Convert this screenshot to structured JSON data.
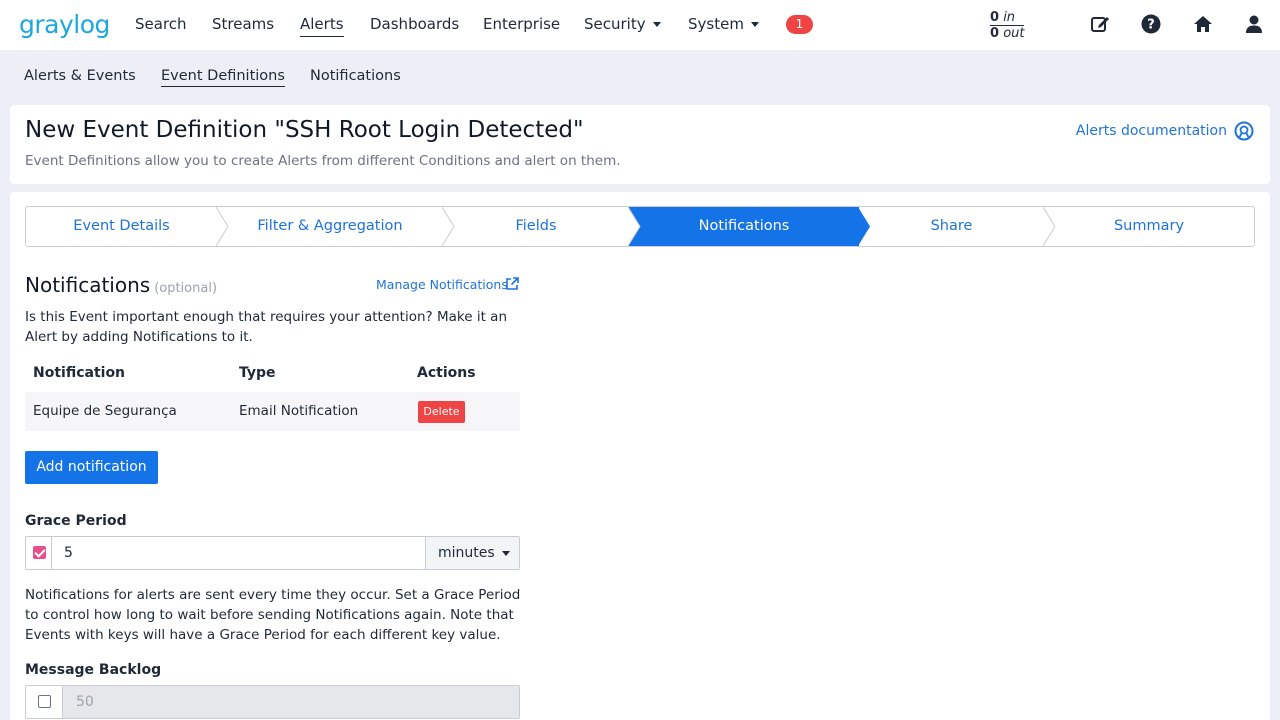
{
  "brand": {
    "logo_text": "graylog",
    "logo_color": "#1ba8e0"
  },
  "topnav": {
    "items": [
      {
        "label": "Search"
      },
      {
        "label": "Streams"
      },
      {
        "label": "Alerts"
      },
      {
        "label": "Dashboards"
      },
      {
        "label": "Enterprise"
      },
      {
        "label": "Security"
      },
      {
        "label": "System"
      }
    ],
    "notification_count": "1",
    "throughput": {
      "in_value": "0",
      "in_label": "in",
      "out_value": "0",
      "out_label": "out"
    },
    "icons": [
      "edit-icon",
      "help-icon",
      "home-icon",
      "user-icon"
    ]
  },
  "subnav": {
    "items": [
      {
        "label": "Alerts & Events"
      },
      {
        "label": "Event Definitions"
      },
      {
        "label": "Notifications"
      }
    ]
  },
  "header": {
    "title": "New Event Definition \"SSH Root Login Detected\"",
    "description": "Event Definitions allow you to create Alerts from different Conditions and alert on them.",
    "docs_link": "Alerts documentation"
  },
  "wizard": {
    "steps": [
      {
        "label": "Event Details"
      },
      {
        "label": "Filter & Aggregation"
      },
      {
        "label": "Fields"
      },
      {
        "label": "Notifications"
      },
      {
        "label": "Share"
      },
      {
        "label": "Summary"
      }
    ],
    "active_step": "Notifications"
  },
  "notifications": {
    "title": "Notifications",
    "optional_label": "(optional)",
    "manage_link": "Manage Notifications",
    "intro": "Is this Event important enough that requires your attention? Make it an Alert by adding Notifications to it.",
    "table": {
      "headers": [
        "Notification",
        "Type",
        "Actions"
      ],
      "rows": [
        {
          "notification": "Equipe de Segurança",
          "type": "Email Notification",
          "action": "Delete"
        }
      ]
    },
    "add_button": "Add notification"
  },
  "grace_period": {
    "label": "Grace Period",
    "enabled": true,
    "value": "5",
    "unit": "minutes",
    "help": "Notifications for alerts are sent every time they occur. Set a Grace Period to control how long to wait before sending Notifications again. Note that Events with keys will have a Grace Period for each different key value."
  },
  "message_backlog": {
    "label": "Message Backlog",
    "enabled": false,
    "value": "50"
  },
  "colors": {
    "accent": "#1473e6",
    "link": "#1e73d8",
    "danger": "#ef4444",
    "checkbox": "#e8508a",
    "background": "#eeeef6"
  }
}
